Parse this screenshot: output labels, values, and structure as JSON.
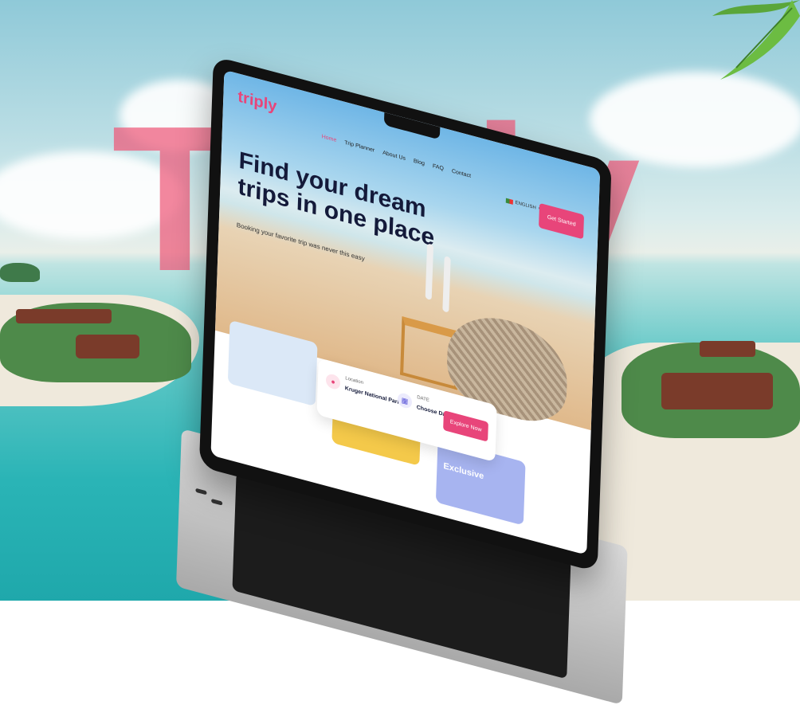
{
  "background": {
    "word": "Triply"
  },
  "site": {
    "logo": "triply",
    "nav": [
      "Home",
      "Trip Planner",
      "About Us",
      "Blog",
      "FAQ",
      "Contact"
    ],
    "active_nav": "Home",
    "language": "ENGLISH",
    "cta": "Get Started"
  },
  "hero": {
    "headline": "Find your dream trips in one place",
    "subtitle": "Booking your favorite trip was never this easy"
  },
  "search": {
    "location_label": "Location",
    "location_value": "Kruger National Park",
    "date_label": "DATE",
    "date_value": "Choose Date",
    "button": "Explore Now"
  },
  "cards": {
    "third_title": "Exclusive"
  },
  "colors": {
    "brand": "#e8457a",
    "navy": "#141a3a"
  }
}
